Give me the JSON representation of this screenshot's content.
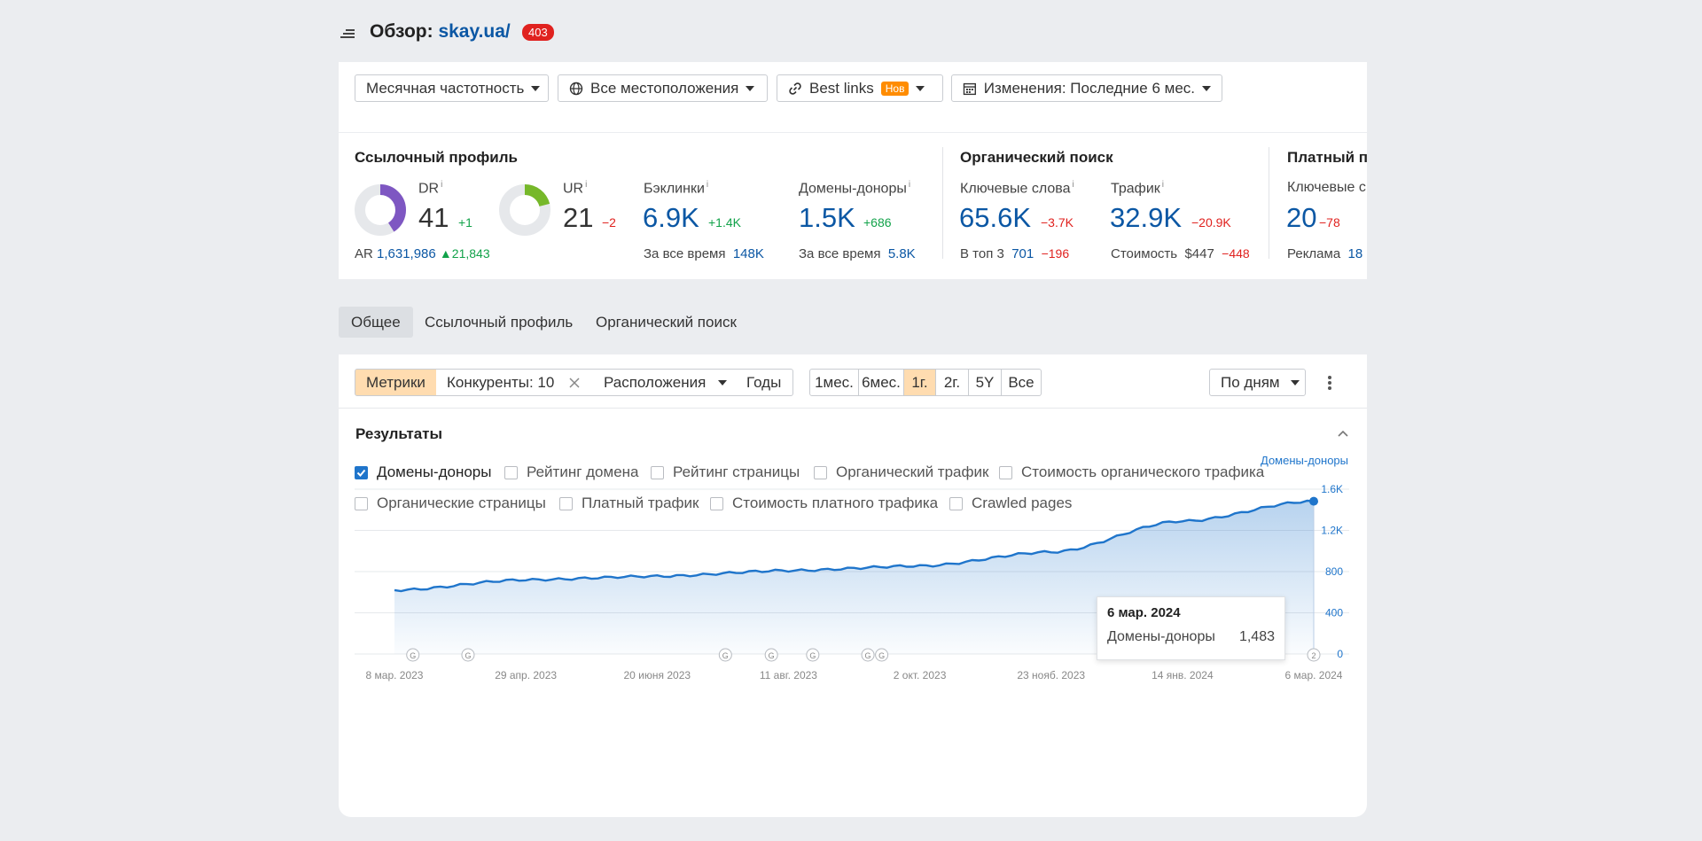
{
  "header": {
    "title_prefix": "Обзор:",
    "domain": "skay.ua/",
    "badge": "403"
  },
  "filters": {
    "frequency": "Месячная частотность",
    "locations": "Все местоположения",
    "best_links": "Best links",
    "best_links_badge": "Нов",
    "changes": "Изменения: Последние 6 мес."
  },
  "metrics": {
    "link_profile": {
      "title": "Ссылочный профиль",
      "dr": {
        "label": "DR",
        "info": "i",
        "value": "41",
        "delta": "+1",
        "gauge": 0.41
      },
      "ur": {
        "label": "UR",
        "info": "i",
        "value": "21",
        "delta": "−2",
        "gauge": 0.21
      },
      "ar": {
        "label": "AR",
        "value": "1,631,986",
        "delta": "▲21,843"
      },
      "backlinks": {
        "label": "Бэклинки",
        "info": "i",
        "value": "6.9K",
        "delta": "+1.4K",
        "sub_label": "За все время",
        "sub_value": "148K"
      },
      "ref_domains": {
        "label": "Домены-доноры",
        "info": "i",
        "value": "1.5K",
        "delta": "+686",
        "sub_label": "За все время",
        "sub_value": "5.8K"
      }
    },
    "organic": {
      "title": "Органический поиск",
      "keywords": {
        "label": "Ключевые слова",
        "info": "i",
        "value": "65.6K",
        "delta": "−3.7K",
        "sub_label": "В топ 3",
        "sub_value": "701",
        "sub_delta": "−196"
      },
      "traffic": {
        "label": "Трафик",
        "info": "i",
        "value": "32.9K",
        "delta": "−20.9K",
        "sub_label": "Стоимость",
        "sub_value": "$447",
        "sub_delta": "−448"
      }
    },
    "paid": {
      "title": "Платный по",
      "keywords": {
        "label": "Ключевые с",
        "value": "20",
        "delta": "−78",
        "sub_label": "Реклама",
        "sub_value": "18"
      }
    }
  },
  "tabs": [
    "Общее",
    "Ссылочный профиль",
    "Органический поиск"
  ],
  "toolbar": {
    "metrics": "Метрики",
    "competitors": "Конкуренты: 10",
    "positions": "Расположения",
    "years": "Годы",
    "ranges": [
      "1мес.",
      "6мес.",
      "1г.",
      "2г.",
      "5Y",
      "Все"
    ],
    "active_range": "1г.",
    "granularity": "По дням"
  },
  "results": {
    "title": "Результаты",
    "checkboxes_row1": [
      {
        "label": "Домены-доноры",
        "checked": true
      },
      {
        "label": "Рейтинг домена",
        "checked": false
      },
      {
        "label": "Рейтинг страницы",
        "checked": false
      },
      {
        "label": "Органический трафик",
        "checked": false
      },
      {
        "label": "Стоимость органического трафика",
        "checked": false
      }
    ],
    "checkboxes_row2": [
      {
        "label": "Органические страницы",
        "checked": false
      },
      {
        "label": "Платный трафик",
        "checked": false
      },
      {
        "label": "Стоимость платного трафика",
        "checked": false
      },
      {
        "label": "Crawled pages",
        "checked": false
      }
    ]
  },
  "chart_data": {
    "type": "area",
    "series": [
      {
        "name": "Домены-доноры",
        "color": "#1f75cb"
      }
    ],
    "legend": "Домены-доноры",
    "ylim": [
      0,
      1600
    ],
    "y_ticks": [
      "1.6K",
      "1.2K",
      "800",
      "400",
      "0"
    ],
    "x_tick_labels": [
      "8 мар. 2023",
      "29 апр. 2023",
      "20 июня 2023",
      "11 авг. 2023",
      "2 окт. 2023",
      "23 нояб. 2023",
      "14 янв. 2024",
      "6 мар. 2024"
    ],
    "x": [
      "8 мар. 2023",
      "29 апр. 2023",
      "20 июня 2023",
      "11 авг. 2023",
      "2 окт. 2023",
      "23 нояб. 2023",
      "14 янв. 2024",
      "6 мар. 2024"
    ],
    "values": [
      620,
      720,
      755,
      810,
      855,
      990,
      1290,
      1483
    ],
    "markers": [
      "G",
      "G",
      "G",
      "G",
      "G",
      "G",
      "G",
      "2"
    ],
    "grid": true,
    "tooltip": {
      "date": "6 мар. 2024",
      "series": "Домены-доноры",
      "value": "1,483"
    }
  }
}
